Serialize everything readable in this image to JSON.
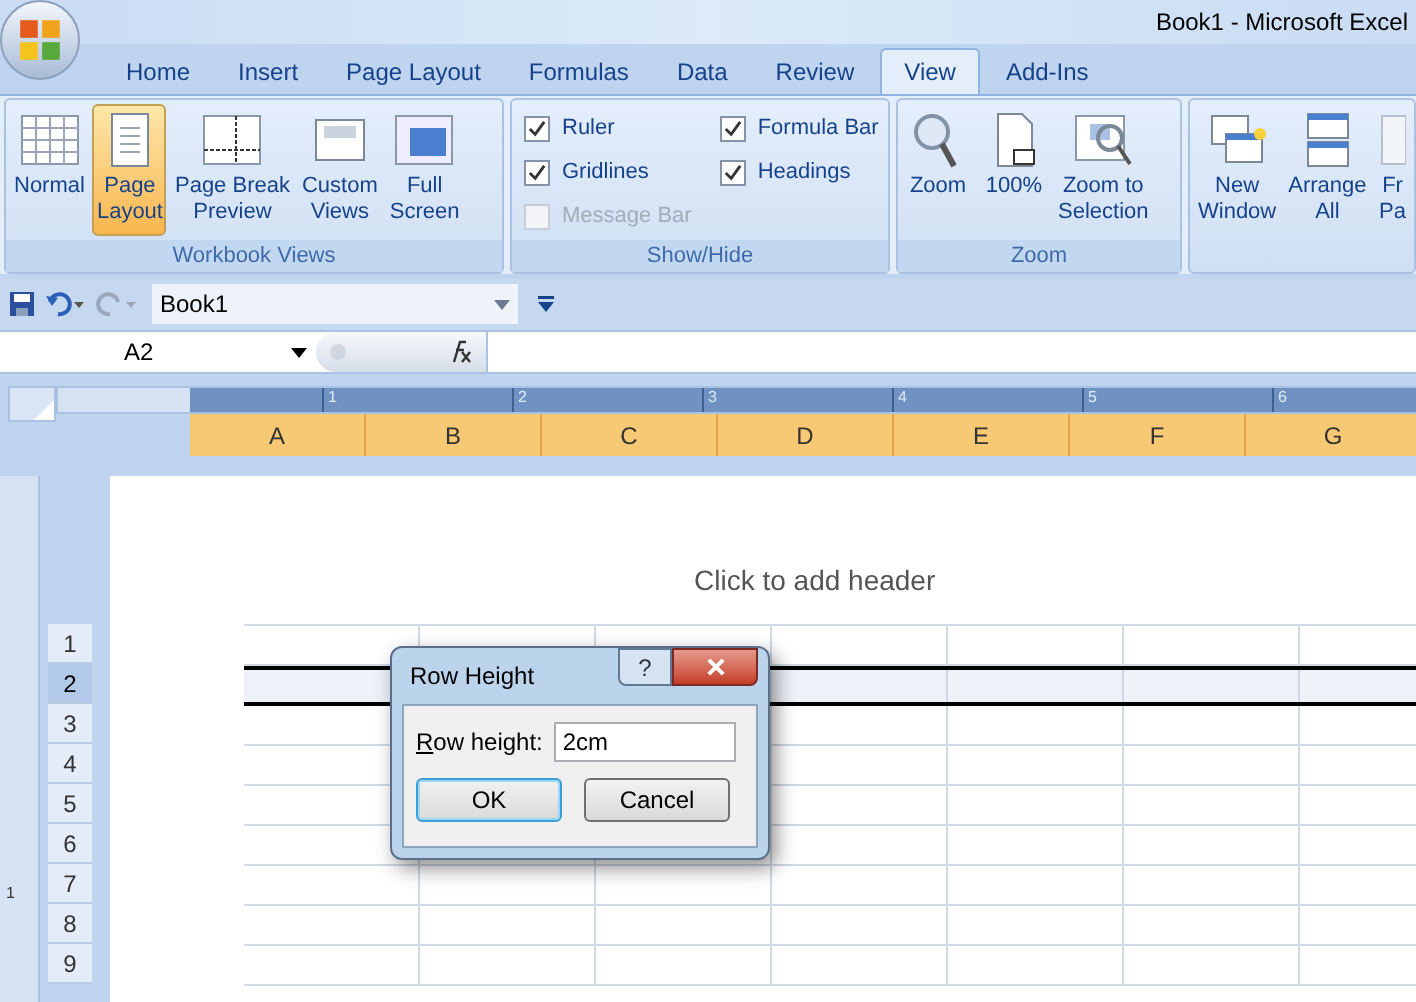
{
  "window": {
    "title": "Book1 - Microsoft Excel"
  },
  "tabs": [
    {
      "label": "Home",
      "selected": false
    },
    {
      "label": "Insert",
      "selected": false
    },
    {
      "label": "Page Layout",
      "selected": false
    },
    {
      "label": "Formulas",
      "selected": false
    },
    {
      "label": "Data",
      "selected": false
    },
    {
      "label": "Review",
      "selected": false
    },
    {
      "label": "View",
      "selected": true
    },
    {
      "label": "Add-Ins",
      "selected": false
    }
  ],
  "ribbon": {
    "groups": [
      {
        "title": "Workbook Views",
        "items": [
          {
            "kind": "button",
            "lines": [
              "Normal"
            ],
            "selected": false
          },
          {
            "kind": "button",
            "lines": [
              "Page",
              "Layout"
            ],
            "selected": true
          },
          {
            "kind": "button",
            "lines": [
              "Page Break",
              "Preview"
            ],
            "selected": false
          },
          {
            "kind": "button",
            "lines": [
              "Custom",
              "Views"
            ],
            "selected": false
          },
          {
            "kind": "button",
            "lines": [
              "Full",
              "Screen"
            ],
            "selected": false
          }
        ]
      },
      {
        "title": "Show/Hide",
        "items": [
          {
            "kind": "checkbox",
            "label": "Ruler",
            "checked": true,
            "disabled": false
          },
          {
            "kind": "checkbox",
            "label": "Gridlines",
            "checked": true,
            "disabled": false
          },
          {
            "kind": "checkbox",
            "label": "Message Bar",
            "checked": false,
            "disabled": true
          },
          {
            "kind": "checkbox",
            "label": "Formula Bar",
            "checked": true,
            "disabled": false
          },
          {
            "kind": "checkbox",
            "label": "Headings",
            "checked": true,
            "disabled": false
          }
        ]
      },
      {
        "title": "Zoom",
        "items": [
          {
            "kind": "button",
            "lines": [
              "Zoom"
            ],
            "selected": false
          },
          {
            "kind": "button",
            "lines": [
              "100%"
            ],
            "selected": false
          },
          {
            "kind": "button",
            "lines": [
              "Zoom to",
              "Selection"
            ],
            "selected": false
          }
        ]
      },
      {
        "items": [
          {
            "kind": "button",
            "lines": [
              "New",
              "Window"
            ],
            "selected": false
          },
          {
            "kind": "button",
            "lines": [
              "Arrange",
              "All"
            ],
            "selected": false
          },
          {
            "kind": "button",
            "lines": [
              "Fr",
              "Pa"
            ],
            "selected": false
          }
        ]
      }
    ]
  },
  "quick_access": {
    "workbook": "Book1"
  },
  "formula_bar": {
    "name_box": "A2"
  },
  "ruler": {
    "marks": [
      "1",
      "2",
      "3",
      "4",
      "5",
      "6"
    ],
    "vertical_marks": [
      "1"
    ]
  },
  "sheet": {
    "header_placeholder": "Click to add header",
    "columns": [
      {
        "label": "A",
        "selected": true
      },
      {
        "label": "B",
        "selected": true
      },
      {
        "label": "C",
        "selected": true
      },
      {
        "label": "D",
        "selected": true
      },
      {
        "label": "E",
        "selected": true
      },
      {
        "label": "F",
        "selected": true
      },
      {
        "label": "G",
        "selected": true
      }
    ],
    "rows": [
      {
        "label": "1",
        "selected": false
      },
      {
        "label": "2",
        "selected": true
      },
      {
        "label": "3",
        "selected": false
      },
      {
        "label": "4",
        "selected": false
      },
      {
        "label": "5",
        "selected": false
      },
      {
        "label": "6",
        "selected": false
      },
      {
        "label": "7",
        "selected": false
      },
      {
        "label": "8",
        "selected": false
      },
      {
        "label": "9",
        "selected": false
      }
    ]
  },
  "dialog": {
    "title": "Row Height",
    "help": "?",
    "field_label": "Row height:",
    "value": "2cm",
    "buttons": [
      {
        "label": "OK",
        "selected": true
      },
      {
        "label": "Cancel",
        "selected": false
      }
    ]
  }
}
